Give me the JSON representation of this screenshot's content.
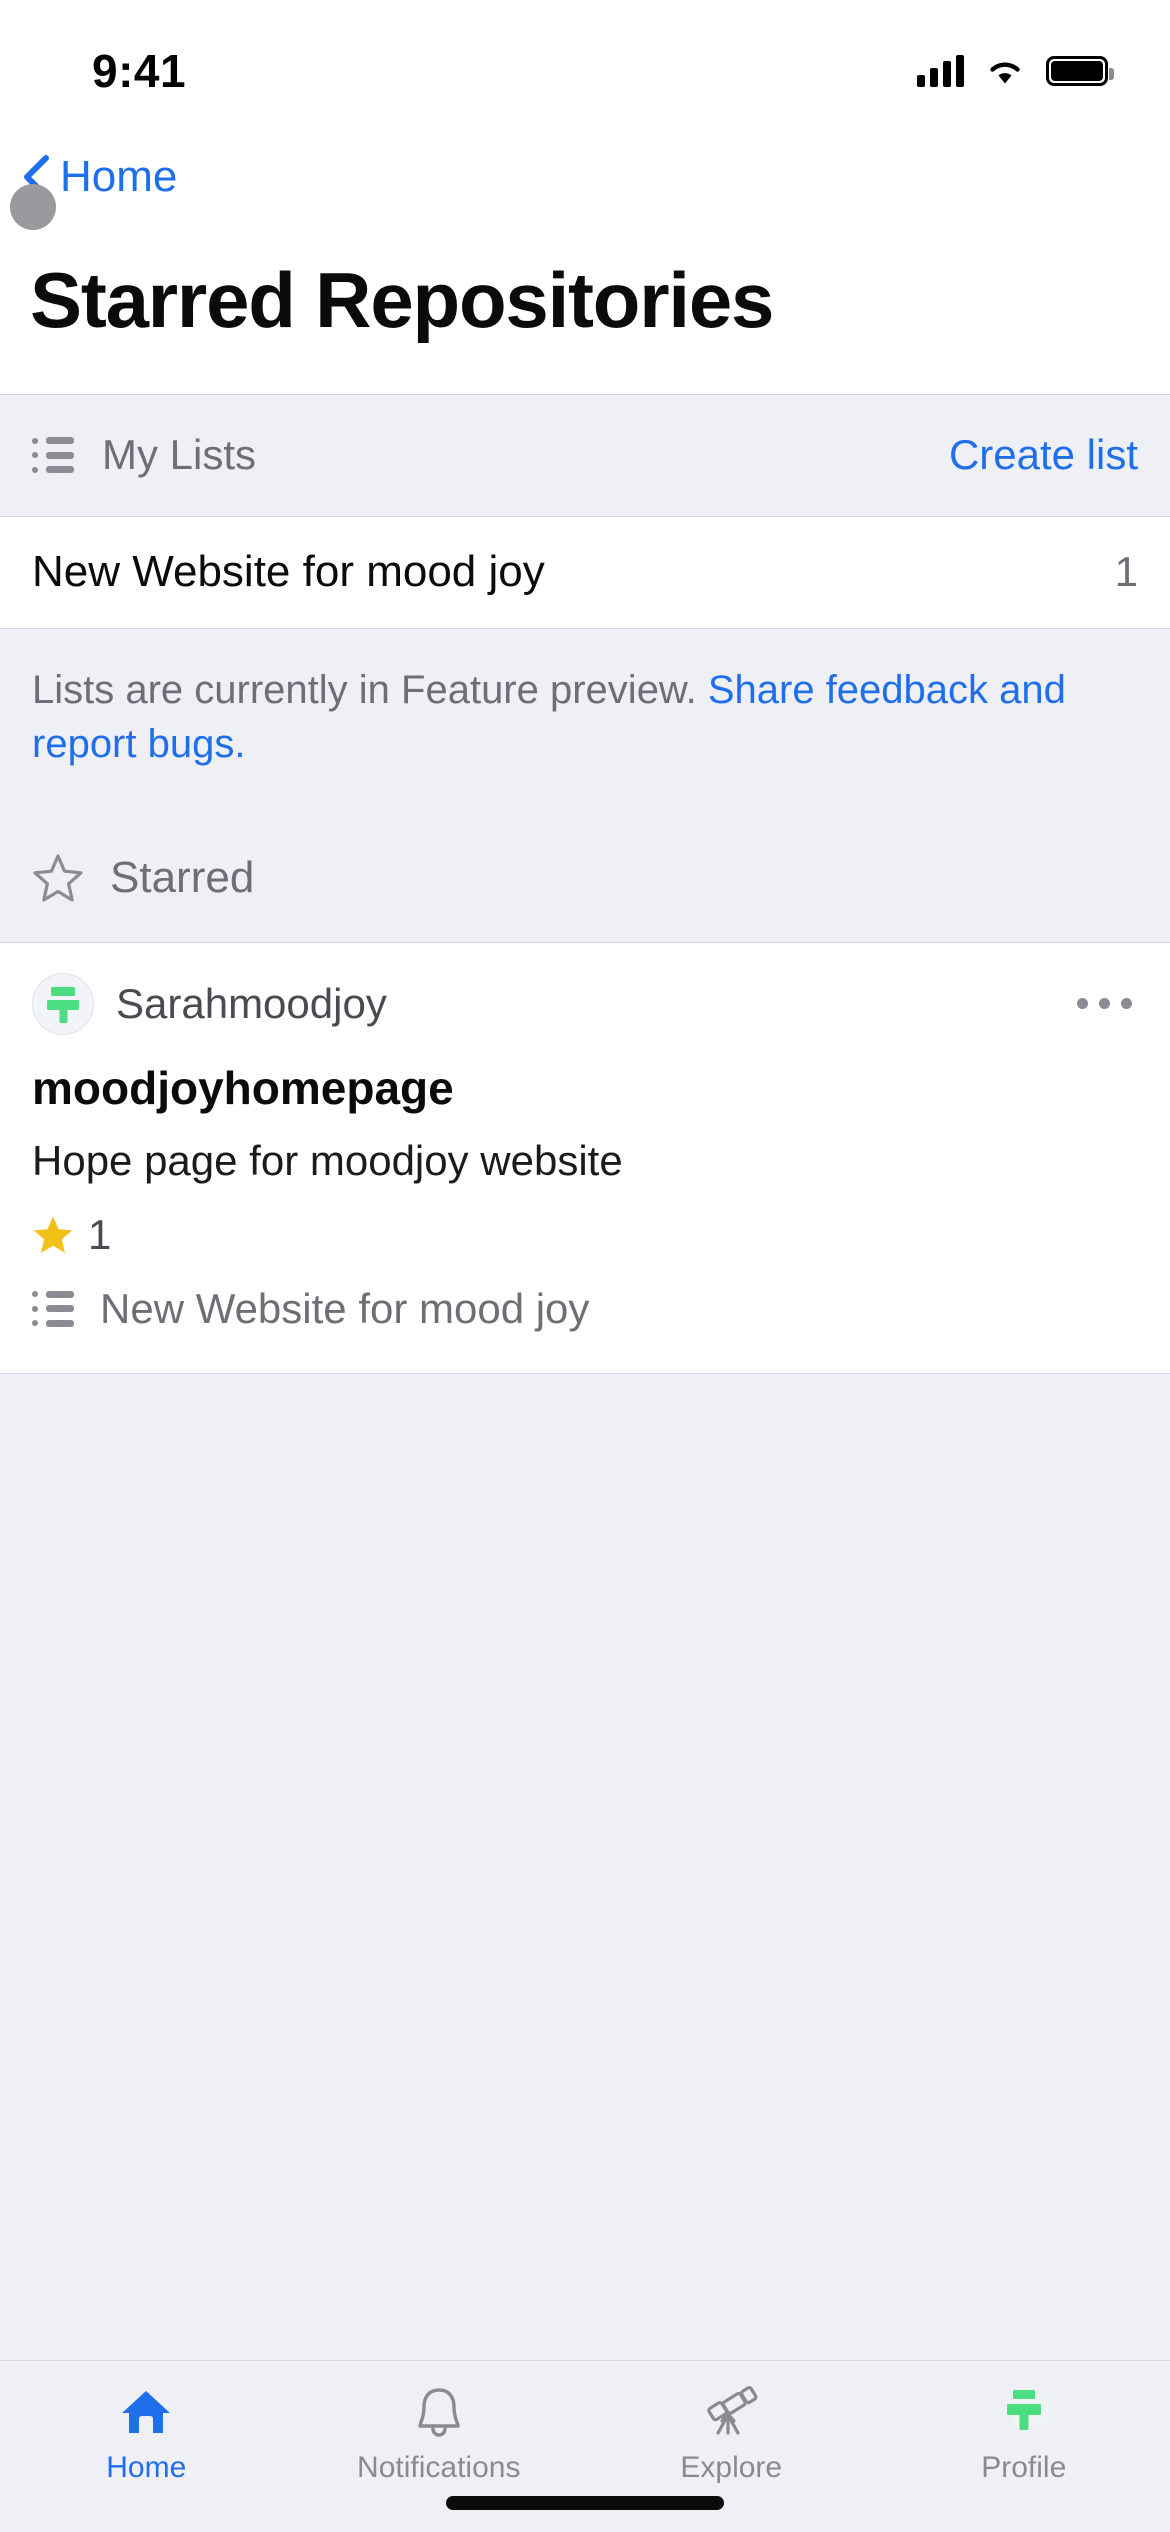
{
  "status_bar": {
    "time": "9:41",
    "signal_icon": "cellular-signal-icon",
    "wifi_icon": "wifi-icon",
    "battery_icon": "battery-icon"
  },
  "nav": {
    "back_label": "Home",
    "back_icon": "chevron-left-icon"
  },
  "header": {
    "title": "Starred Repositories"
  },
  "my_lists_section": {
    "icon": "list-icon",
    "label": "My Lists",
    "action_label": "Create list"
  },
  "lists": [
    {
      "name": "New Website for mood joy",
      "count": "1"
    }
  ],
  "preview_note": {
    "text": "Lists are currently in Feature preview. ",
    "link_text": "Share feedback and report bugs."
  },
  "starred_section": {
    "icon": "star-outline-icon",
    "label": "Starred"
  },
  "repositories": [
    {
      "avatar_icon": "moodjoy-avatar-icon",
      "owner": "Sarahmoodjoy",
      "name": "moodjoyhomepage",
      "description": "Hope page for moodjoy website",
      "star_icon": "star-filled-icon",
      "star_count": "1",
      "list_icon": "list-icon",
      "list_tag": "New Website for mood joy",
      "menu_icon": "ellipsis-icon"
    }
  ],
  "tabbar": {
    "items": [
      {
        "label": "Home",
        "icon": "home-icon",
        "active": true
      },
      {
        "label": "Notifications",
        "icon": "bell-icon",
        "active": false
      },
      {
        "label": "Explore",
        "icon": "telescope-icon",
        "active": false
      },
      {
        "label": "Profile",
        "icon": "profile-avatar-icon",
        "active": false
      }
    ]
  },
  "colors": {
    "accent_blue": "#1f6feb",
    "bg_gray": "#eff0f5",
    "card_white": "#ffffff",
    "text_secondary": "#6e6e76",
    "star_yellow": "#f1c117",
    "brand_green": "#4ade80"
  }
}
